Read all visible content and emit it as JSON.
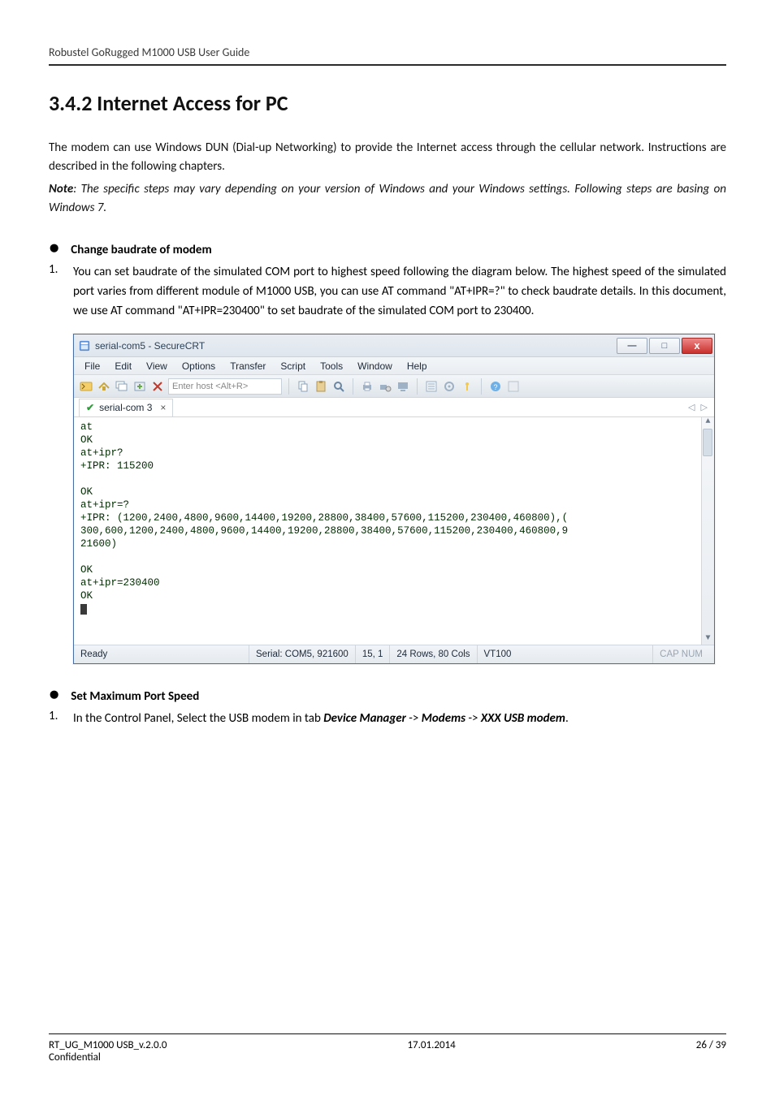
{
  "doc": {
    "header_title": "Robustel GoRugged M1000 USB User Guide",
    "section_number_title": "3.4.2  Internet Access for PC",
    "intro_p1": "The modem can use Windows DUN (Dial-up Networking) to provide the Internet access through the cellular network. Instructions are described in the following chapters.",
    "note_label": "Note",
    "note_text": ": The specific steps may vary depending on your version of Windows and your Windows settings. Following steps are basing on Windows 7.",
    "bullet1": "Change baudrate of modem",
    "step1": "You can set baudrate of the simulated COM port to highest speed following the diagram below. The highest speed of the simulated port varies from different module of M1000 USB, you can use AT command \"AT+IPR=?\" to check baudrate details. In this document, we use AT command \"AT+IPR=230400\" to set baudrate of the simulated COM port to 230400.",
    "bullet2": "Set Maximum Port Speed",
    "step2_pre": "In the Control Panel, Select the USB modem in tab ",
    "step2_dm": "Device Manager",
    "step2_arrow": " -> ",
    "step2_modems": "Modems",
    "step2_xxx": "XXX USB modem",
    "step2_period": "."
  },
  "crt": {
    "title": "serial-com5 - SecureCRT",
    "menus": [
      "File",
      "Edit",
      "View",
      "Options",
      "Transfer",
      "Script",
      "Tools",
      "Window",
      "Help"
    ],
    "host_placeholder": "Enter host <Alt+R>",
    "tab_label": "serial-com 3",
    "tab_close_glyph": "×",
    "tab_check_glyph": "✔",
    "tab_scroll_glyphs": "◁  ▷",
    "minimize_glyph": "—",
    "maximize_glyph": "□",
    "close_glyph": "x",
    "scroll_up_glyph": "▲",
    "scroll_down_glyph": "▼",
    "terminal_lines": "at\nOK\nat+ipr?\n+IPR: 115200\n\nOK\nat+ipr=?\n+IPR: (1200,2400,4800,9600,14400,19200,28800,38400,57600,115200,230400,460800),(\n300,600,1200,2400,4800,9600,14400,19200,28800,38400,57600,115200,230400,460800,9\n21600)\n\nOK\nat+ipr=230400\nOK",
    "status": {
      "ready": "Ready",
      "port": "Serial: COM5, 921600",
      "cursor": "15, 1",
      "size": "24 Rows, 80 Cols",
      "emu": "VT100",
      "right": "CAP  NUM"
    }
  },
  "footer": {
    "left1": "RT_UG_M1000 USB_v.2.0.0",
    "left2": "Confidential",
    "center": "17.01.2014",
    "right": "26 / 39"
  }
}
